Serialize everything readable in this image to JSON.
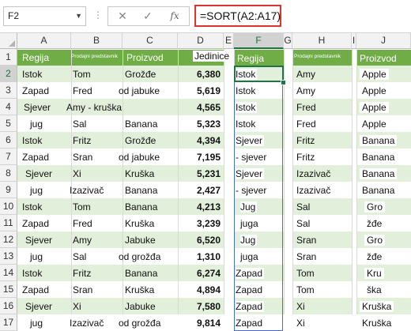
{
  "formula_bar": {
    "name_box": "F2",
    "cancel_glyph": "✕",
    "enter_glyph": "✓",
    "fx_label": "fx",
    "formula": "=SORT(A2:A17)"
  },
  "columns": [
    "A",
    "B",
    "C",
    "D",
    "E",
    "F",
    "G",
    "H",
    "I",
    "J"
  ],
  "selected_column": "F",
  "selected_row": "2",
  "rows": [
    "1",
    "2",
    "3",
    "4",
    "5",
    "6",
    "7",
    "8",
    "9",
    "10",
    "11",
    "12",
    "13",
    "14",
    "15",
    "16",
    "17"
  ],
  "headers": {
    "a": "Regija",
    "b": "Prodajni predstavnik",
    "c": "Proizvod",
    "d": "Jedinice",
    "f": "Regija",
    "h": "Prodajni predstavnik",
    "j": "Proizvod"
  },
  "source_table": [
    {
      "region": "Istok",
      "rep": "Tom",
      "product": "Grožđe",
      "units": "6,380"
    },
    {
      "region": "Zapad",
      "rep": "Fred",
      "product": "od jabuke",
      "units": "5,619"
    },
    {
      "region": "Sjever",
      "rep": "Amy - kruška",
      "product": "",
      "units": "4,565"
    },
    {
      "region": "jug",
      "rep": "Sal",
      "product": "Banana",
      "units": "5,323"
    },
    {
      "region": "Istok",
      "rep": "Fritz",
      "product": "Grožđe",
      "units": "4,394"
    },
    {
      "region": "Zapad",
      "rep": "Sran",
      "product": "od jabuke",
      "units": "7,195"
    },
    {
      "region": "Sjever",
      "rep": "Xi",
      "product": "Kruška",
      "units": "5,231"
    },
    {
      "region": "jug",
      "rep": "Izazivač",
      "product": "Banana",
      "units": "2,427"
    },
    {
      "region": "Istok",
      "rep": "Tom",
      "product": "Banana",
      "units": "4,213"
    },
    {
      "region": "Zapad",
      "rep": "Fred",
      "product": "Kruška",
      "units": "3,239"
    },
    {
      "region": "Sjever",
      "rep": "Amy",
      "product": "Jabuke",
      "units": "6,520"
    },
    {
      "region": "jug",
      "rep": "Sal",
      "product": "od grožđa",
      "units": "1,310"
    },
    {
      "region": "Istok",
      "rep": "Fritz",
      "product": "Banana",
      "units": "6,274"
    },
    {
      "region": "Zapad",
      "rep": "Sran",
      "product": "Kruška",
      "units": "4,894"
    },
    {
      "region": "Sjever",
      "rep": "Xi",
      "product": "Jabuke",
      "units": "7,580"
    },
    {
      "region": "jug",
      "rep": "Izazivač",
      "product": "od grožđa",
      "units": "9,814"
    }
  ],
  "sorted_regions": [
    "Istok",
    "Istok",
    "Istok",
    "Istok",
    "Sjever",
    "- sjever",
    "Sjever",
    "- sjever",
    "Jug",
    "juga",
    "Jug",
    "juga",
    "Zapad",
    "Zapad",
    "Zapad",
    "Zapad"
  ],
  "col_h": [
    "Amy",
    "Amy",
    "Fred",
    "Fred",
    "Fritz",
    "Fritz",
    "Izazivač",
    "Izazivač",
    "Sal",
    "Sal",
    "Sran",
    "Sran",
    "Tom",
    "Tom",
    "Xi",
    "Xi"
  ],
  "col_j": [
    "Apple",
    "Apple",
    "Apple",
    "Apple",
    "Banana",
    "Banana",
    "Banana",
    "Banana",
    "Gro",
    "žđe",
    "Gro",
    "žđe",
    "Kru",
    "ška",
    "Kruška",
    "Kruška"
  ],
  "colors": {
    "header_green": "#70ad47",
    "band_green": "#e2efda",
    "formula_border": "#e0312b",
    "spill_border": "#4472c4",
    "selection": "#217346"
  }
}
